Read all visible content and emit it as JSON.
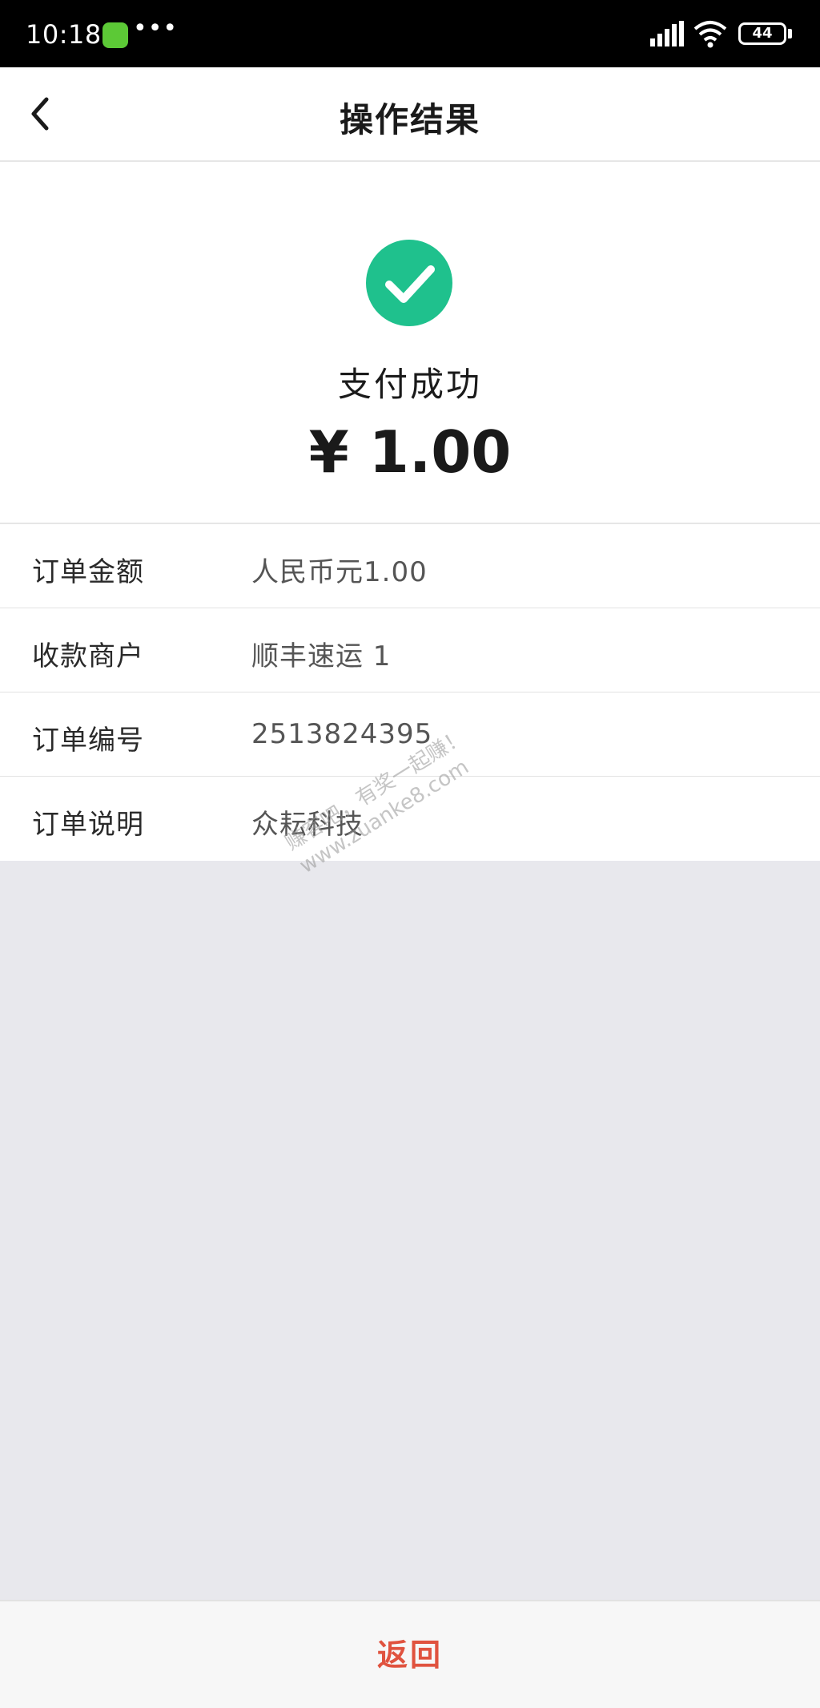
{
  "status_bar": {
    "time": "10:18",
    "dots": "•••",
    "battery": "44",
    "icons": [
      "app-notification-icon",
      "signal-icon",
      "wifi-icon",
      "battery-icon"
    ]
  },
  "nav": {
    "title": "操作结果",
    "back_icon": "chevron-left-icon"
  },
  "result": {
    "icon": "check-circle-icon",
    "status": "支付成功",
    "amount": "¥ 1.00"
  },
  "details": [
    {
      "label": "订单金额",
      "value": "人民币元1.00"
    },
    {
      "label": "收款商户",
      "value": "顺丰速运 1"
    },
    {
      "label": "订单编号",
      "value": "2513824395"
    },
    {
      "label": "订单说明",
      "value": "众耘科技"
    }
  ],
  "watermark": {
    "line1": "赚客吧，有奖一起赚！",
    "line2": "www.zuanke8.com"
  },
  "footer": {
    "return_label": "返回"
  },
  "colors": {
    "success_green": "#1fc18d",
    "return_red": "#e0533f",
    "background": "#e8e8ed"
  }
}
